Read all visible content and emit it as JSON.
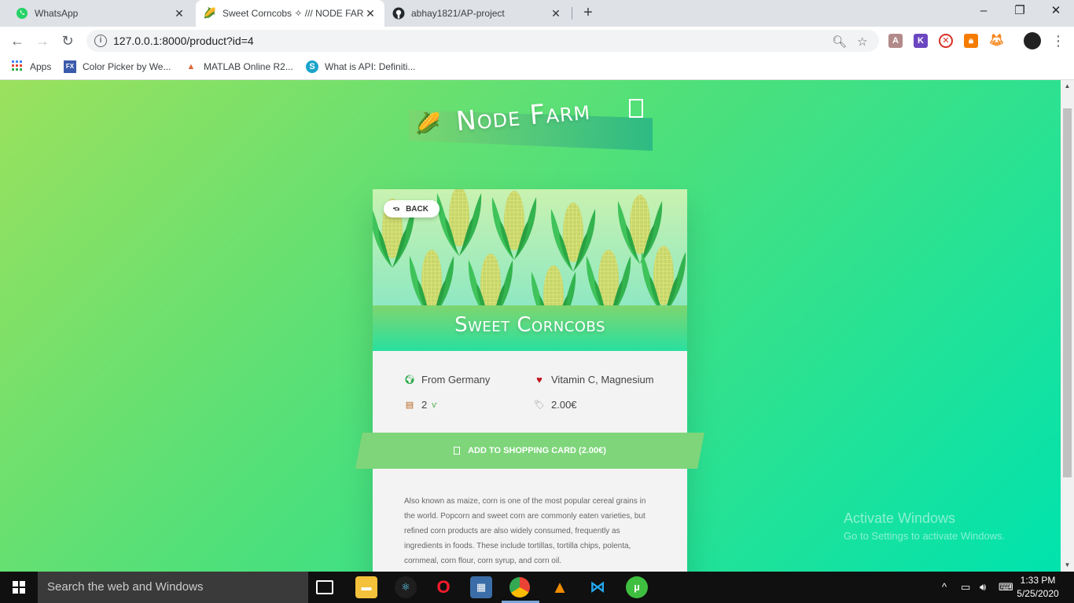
{
  "browser": {
    "tabs": [
      {
        "title": "WhatsApp",
        "icon": "whatsapp-icon",
        "active": false
      },
      {
        "title": "Sweet Corncobs ✧ /// NODE FAR",
        "icon": "corn-icon",
        "active": true
      },
      {
        "title": "abhay1821/AP-project",
        "icon": "github-icon",
        "active": false
      }
    ],
    "new_tab": "+",
    "window_controls": {
      "minimize": "–",
      "maximize": "❐",
      "close": "✕"
    },
    "url": "127.0.0.1:8000/product?id=4",
    "bookmarks": [
      {
        "label": "Apps",
        "icon": "apps-grid-icon"
      },
      {
        "label": "Color Picker by We...",
        "icon": "fx-icon"
      },
      {
        "label": "MATLAB Online R2...",
        "icon": "matlab-icon"
      },
      {
        "label": "What is API: Definiti...",
        "icon": "api-icon"
      }
    ],
    "accent": "#1a73e8"
  },
  "page": {
    "logo_text": "Node Farm",
    "back_label": "BACK",
    "product_name": "Sweet Corncobs",
    "from": "From Germany",
    "nutrients": "Vitamin C, Magnesium",
    "quantity": "2",
    "price": "2.00€",
    "cta": "ADD TO SHOPPING CARD (2.00€)",
    "description": "Also known as maize, corn is one of the most popular cereal grains in the world. Popcorn and sweet corn are commonly eaten varieties, but refined corn products are also widely consumed, frequently as ingredients in foods. These include tortillas, tortilla chips, polenta, cornmeal, corn flour, corn syrup, and corn oil.",
    "colors": {
      "gradient_start": "#9be15d",
      "gradient_end": "#00e3ae",
      "brand_green": "#7ed56f"
    }
  },
  "watermark": {
    "title": "Activate Windows",
    "subtitle": "Go to Settings to activate Windows."
  },
  "taskbar": {
    "search_placeholder": "Search the web and Windows",
    "time": "1:33 PM",
    "date": "5/25/2020"
  }
}
